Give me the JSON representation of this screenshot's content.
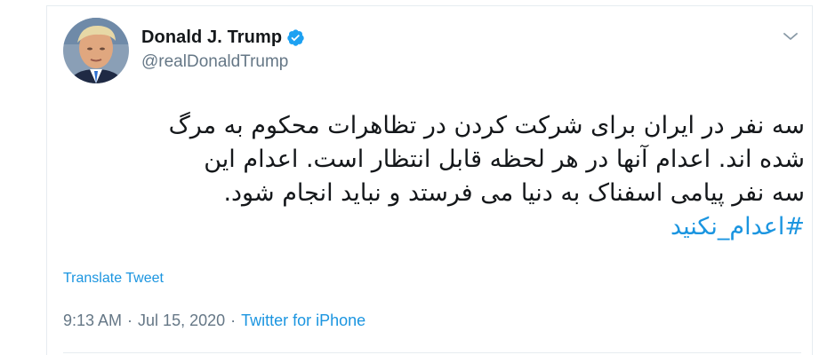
{
  "author": {
    "display_name": "Donald J. Trump",
    "handle": "@realDonaldTrump",
    "verified": true
  },
  "tweet": {
    "lines": [
      "سه نفر در ایران برای شرکت کردن در تظاهرات محکوم به مرگ",
      "شده اند. اعدام آنها در هر لحظه قابل انتظار است. اعدام این",
      "سه نفر پیامی اسفناک به دنیا می فرستد و نباید انجام شود."
    ],
    "hashtag": "#اعدام_نکنید",
    "translate_label": "Translate Tweet",
    "time": "9:13 AM",
    "date": "Jul 15, 2020",
    "source": "Twitter for iPhone",
    "separator": "·"
  },
  "icons": {
    "verified": "verified-badge-icon",
    "menu": "chevron-down-icon"
  },
  "colors": {
    "link": "#1b95e0",
    "text": "#14171a",
    "muted": "#657786",
    "verified": "#1da1f2"
  }
}
